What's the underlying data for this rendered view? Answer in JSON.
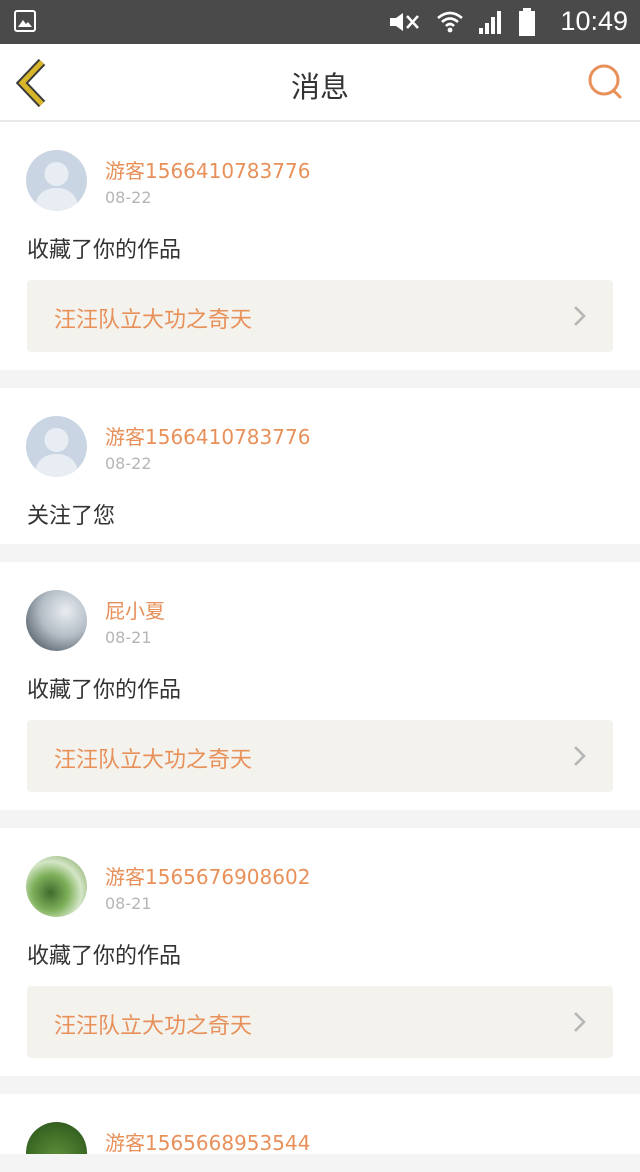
{
  "status_bar": {
    "time": "10:49",
    "icons": [
      "gallery-icon",
      "mute-icon",
      "wifi-icon",
      "signal-icon",
      "battery-icon"
    ]
  },
  "header": {
    "title": "消息",
    "back_icon": "chevron-left-icon",
    "search_icon": "search-icon"
  },
  "theme": {
    "accent": "#e8905a",
    "back_arrow": "#d8b62a",
    "work_box_bg": "#f3f2ec"
  },
  "notifications": [
    {
      "username": "游客1566410783776",
      "date": "08-22",
      "action": "收藏了你的作品",
      "work_title": "汪汪队立大功之奇天",
      "avatar": "default-avatar"
    },
    {
      "username": "游客1566410783776",
      "date": "08-22",
      "action": "关注了您",
      "avatar": "default-avatar"
    },
    {
      "username": "屁小夏",
      "date": "08-21",
      "action": "收藏了你的作品",
      "work_title": "汪汪队立大功之奇天",
      "avatar": "photo-avatar"
    },
    {
      "username": "游客1565676908602",
      "date": "08-21",
      "action": "收藏了你的作品",
      "work_title": "汪汪队立大功之奇天",
      "avatar": "photo-avatar"
    },
    {
      "username": "游客1565668953544",
      "avatar": "photo-avatar"
    }
  ]
}
